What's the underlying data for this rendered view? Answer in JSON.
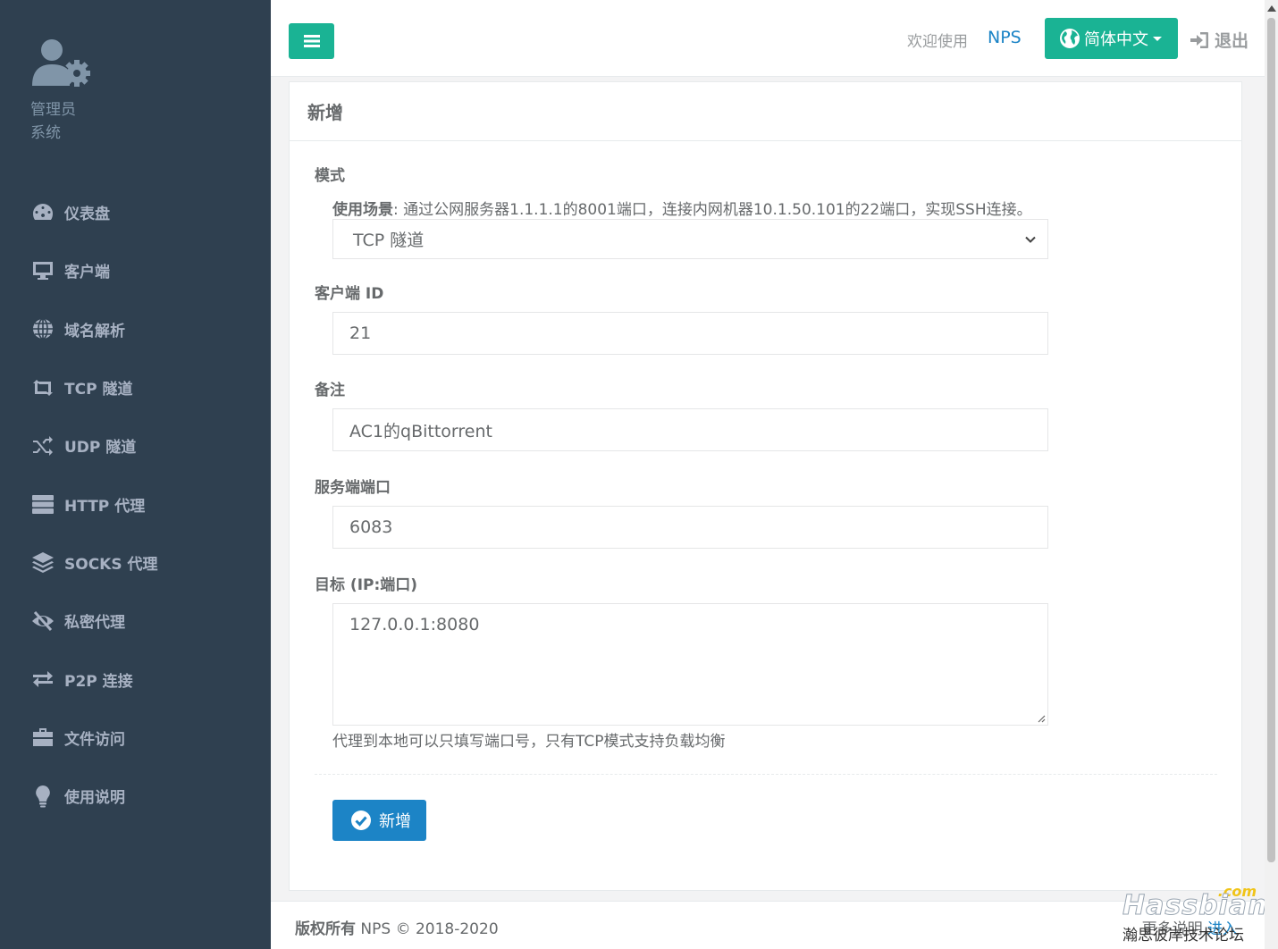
{
  "sidebar": {
    "profile": {
      "role": "管理员",
      "name": "系统"
    },
    "items": [
      {
        "label": "仪表盘",
        "icon": "dashboard-icon"
      },
      {
        "label": "客户端",
        "icon": "monitor-icon"
      },
      {
        "label": "域名解析",
        "icon": "globe-icon"
      },
      {
        "label": "TCP 隧道",
        "icon": "retweet-icon"
      },
      {
        "label": "UDP 隧道",
        "icon": "random-icon"
      },
      {
        "label": "HTTP 代理",
        "icon": "server-icon"
      },
      {
        "label": "SOCKS 代理",
        "icon": "layers-icon"
      },
      {
        "label": "私密代理",
        "icon": "eye-slash-icon"
      },
      {
        "label": "P2P 连接",
        "icon": "exchange-icon"
      },
      {
        "label": "文件访问",
        "icon": "briefcase-icon"
      },
      {
        "label": "使用说明",
        "icon": "lightbulb-icon"
      }
    ]
  },
  "header": {
    "welcome": "欢迎使用",
    "brand": "NPS",
    "language": "简体中文",
    "logout": "退出"
  },
  "form": {
    "title": "新增",
    "mode": {
      "label": "模式",
      "scenario_label": "使用场景",
      "scenario_text": ": 通过公网服务器1.1.1.1的8001端口，连接内网机器10.1.50.101的22端口，实现SSH连接。",
      "value": "TCP 隧道"
    },
    "client_id": {
      "label": "客户端 ID",
      "value": "21"
    },
    "remark": {
      "label": "备注",
      "value": "AC1的qBittorrent"
    },
    "server_port": {
      "label": "服务端端口",
      "value": "6083"
    },
    "target": {
      "label": "目标 (IP:端口)",
      "value": "127.0.0.1:8080",
      "hint": "代理到本地可以只填写端口号，只有TCP模式支持负载均衡"
    },
    "submit_label": "新增"
  },
  "footer": {
    "copyright_label": "版权所有",
    "copyright_text": " NPS © 2018-2020",
    "more_label": "更多说明",
    "more_link": "进入"
  },
  "watermark": {
    "com": ".com",
    "brand": "Hassbian",
    "sub": "瀚思彼岸技术论坛"
  },
  "colors": {
    "sidebar_bg": "#2f4050",
    "primary": "#1ab394",
    "link": "#1c84c6"
  }
}
